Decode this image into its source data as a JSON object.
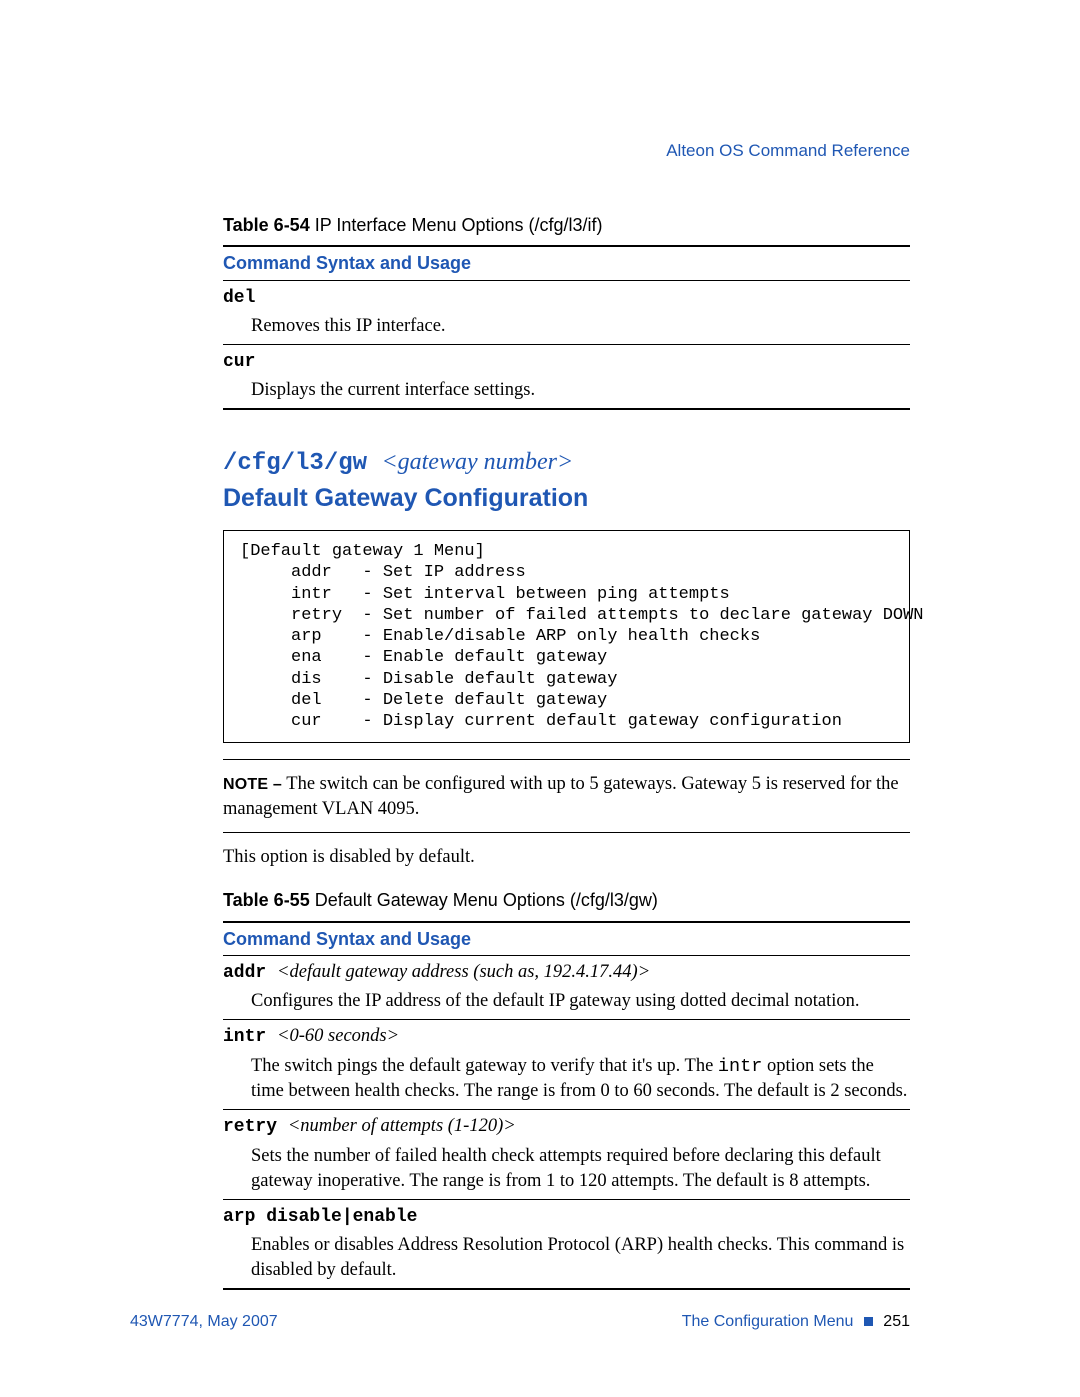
{
  "runningHead": "Alteon OS  Command Reference",
  "table54": {
    "captionBold": "Table 6-54",
    "captionText": "  IP Interface Menu Options (/cfg/l3/if)",
    "columnHead": "Command Syntax and Usage",
    "rows": [
      {
        "name": "del",
        "desc": "Removes this IP interface."
      },
      {
        "name": "cur",
        "desc": "Displays the current interface settings."
      }
    ]
  },
  "sectionHead": {
    "path": "/cfg/l3/gw ",
    "param": "<gateway number>",
    "title": "Default Gateway Configuration"
  },
  "menuBox": "[Default gateway 1 Menu]\n     addr   - Set IP address\n     intr   - Set interval between ping attempts\n     retry  - Set number of failed attempts to declare gateway DOWN\n     arp    - Enable/disable ARP only health checks\n     ena    - Enable default gateway\n     dis    - Disable default gateway\n     del    - Delete default gateway\n     cur    - Display current default gateway configuration",
  "note": {
    "label": "NOTE –",
    "text": " The switch can be configured with up to 5 gateways. Gateway 5 is reserved for the management VLAN 4095."
  },
  "bodyP": "This option is disabled by default.",
  "table55": {
    "captionBold": "Table 6-55",
    "captionText": "  Default Gateway Menu Options (/cfg/l3/gw)",
    "columnHead": "Command Syntax and Usage",
    "rows": [
      {
        "name": "addr ",
        "param": "<default gateway address (such as, 192.4.17.44)>",
        "desc": "Configures the IP address of the default IP gateway using dotted decimal notation."
      },
      {
        "name": "intr ",
        "param": "<0-60 seconds>",
        "descPre": "The switch pings the default gateway to verify that it's up. The ",
        "descMono": "intr",
        "descPost": " option sets the time between health checks. The range is from 0 to 60 seconds. The default is 2 seconds."
      },
      {
        "name": "retry ",
        "param": "<number of attempts (1-120)>",
        "desc": "Sets the number of failed health check attempts required before declaring this default gateway inoperative. The range is from 1 to 120 attempts. The default is 8 attempts."
      },
      {
        "name": "arp disable|enable",
        "desc": "Enables or disables Address Resolution Protocol (ARP) health checks. This command is disabled by default."
      }
    ]
  },
  "footer": {
    "left": "43W7774, May 2007",
    "rightLabel": "The Configuration Menu",
    "pageNum": "251"
  }
}
